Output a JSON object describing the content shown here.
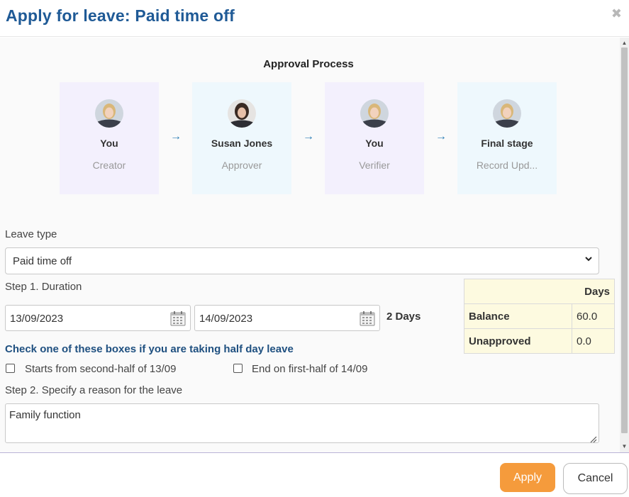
{
  "dialog": {
    "title": "Apply for leave: Paid time off",
    "close_icon": "close-icon"
  },
  "approval": {
    "title": "Approval Process",
    "stages": [
      {
        "name": "You",
        "role": "Creator",
        "bg": "#f3f0fd"
      },
      {
        "name": "Susan Jones",
        "role": "Approver",
        "bg": "#eef8fd"
      },
      {
        "name": "You",
        "role": "Verifier",
        "bg": "#f3f0fd"
      },
      {
        "name": "Final stage",
        "role": "Record Upd...",
        "bg": "#eef8fd"
      }
    ],
    "arrow": "→"
  },
  "leave_type": {
    "label": "Leave type",
    "value": "Paid time off"
  },
  "duration": {
    "label": "Step 1. Duration",
    "from": "13/09/2023",
    "to": "14/09/2023",
    "total": "2 Days"
  },
  "balance": {
    "header": "Days",
    "rows": [
      {
        "key": "Balance",
        "value": "60.0"
      },
      {
        "key": "Unapproved",
        "value": "0.0"
      }
    ]
  },
  "half_day": {
    "title": "Check one of these boxes if you are taking half day leave",
    "options": [
      {
        "label": "Starts from second-half of 13/09",
        "checked": false
      },
      {
        "label": "End on first-half of 14/09",
        "checked": false
      }
    ]
  },
  "reason": {
    "label": "Step 2. Specify a reason for the leave",
    "value": "Family function"
  },
  "footer": {
    "apply": "Apply",
    "cancel": "Cancel"
  },
  "colors": {
    "title": "#1f5a96",
    "apply": "#f59b3c",
    "accent": "#2a7db5"
  }
}
